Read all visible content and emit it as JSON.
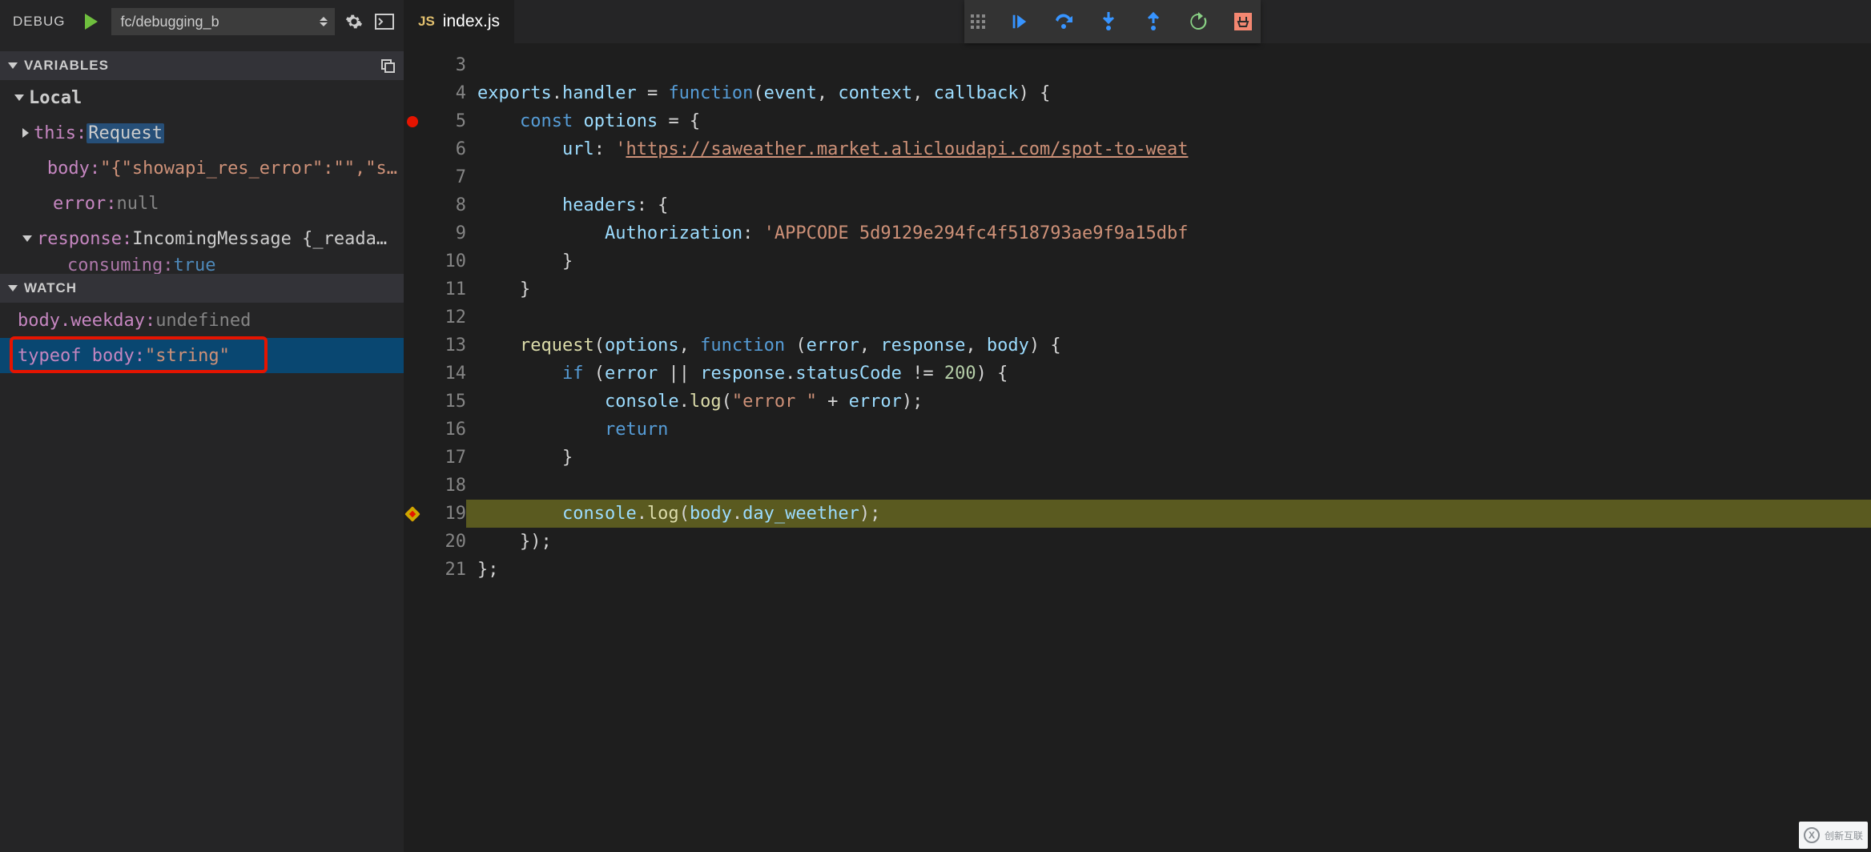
{
  "debug": {
    "title": "DEBUG",
    "config_name": "fc/debugging_b"
  },
  "sections": {
    "variables_title": "VARIABLES",
    "watch_title": "WATCH"
  },
  "variables": {
    "scope_local": "Local",
    "rows": [
      {
        "name": "this",
        "value": "Request",
        "indent": 28,
        "arrow": "collapsed",
        "valClass": "highlighted-val"
      },
      {
        "name": "body",
        "value": "\"{\"showapi_res_error\":\"\",\"s…",
        "indent": 46,
        "arrow": "",
        "valClass": "var-value str"
      },
      {
        "name": "error",
        "value": "null",
        "indent": 46,
        "arrow": "",
        "valClass": "var-value null"
      },
      {
        "name": "response",
        "value": "IncomingMessage {_reada…",
        "indent": 28,
        "arrow": "expanded",
        "valClass": "var-value obj"
      },
      {
        "name": "consuming",
        "value": "true",
        "indent": 64,
        "arrow": "",
        "valClass": "var-value bool",
        "truncated": true
      }
    ]
  },
  "watch": [
    {
      "expr": "body.weekday",
      "value": "undefined",
      "valClass": "var-value null"
    },
    {
      "expr": "typeof body",
      "value": "\"string\"",
      "valClass": "var-value str",
      "selected": true,
      "boxed": true
    }
  ],
  "editor": {
    "filename": "index.js",
    "lang_badge": "JS",
    "lines": [
      {
        "n": 3,
        "bp": "",
        "current": false,
        "tokens": []
      },
      {
        "n": 4,
        "bp": "",
        "current": false,
        "tokens": [
          [
            "id",
            "exports"
          ],
          [
            "pun",
            "."
          ],
          [
            "id",
            "handler"
          ],
          [
            "plain",
            " "
          ],
          [
            "pun",
            "="
          ],
          [
            "plain",
            " "
          ],
          [
            "kw",
            "function"
          ],
          [
            "pun",
            "("
          ],
          [
            "id",
            "event"
          ],
          [
            "pun",
            ", "
          ],
          [
            "id",
            "context"
          ],
          [
            "pun",
            ", "
          ],
          [
            "id",
            "callback"
          ],
          [
            "pun",
            ") {"
          ]
        ]
      },
      {
        "n": 5,
        "bp": "dot",
        "current": false,
        "pad": "    ",
        "tokens": [
          [
            "kw",
            "const"
          ],
          [
            "plain",
            " "
          ],
          [
            "id",
            "options"
          ],
          [
            "plain",
            " "
          ],
          [
            "pun",
            "="
          ],
          [
            "plain",
            " {"
          ]
        ]
      },
      {
        "n": 6,
        "bp": "",
        "current": false,
        "pad": "        ",
        "tokens": [
          [
            "prop",
            "url"
          ],
          [
            "pun",
            ":"
          ],
          [
            "plain",
            " "
          ],
          [
            "str",
            "'"
          ],
          [
            "strU",
            "https://saweather.market.alicloudapi.com/spot-to-weat"
          ]
        ]
      },
      {
        "n": 7,
        "bp": "",
        "current": false,
        "tokens": []
      },
      {
        "n": 8,
        "bp": "",
        "current": false,
        "pad": "        ",
        "tokens": [
          [
            "prop",
            "headers"
          ],
          [
            "pun",
            ":"
          ],
          [
            "plain",
            " {"
          ]
        ]
      },
      {
        "n": 9,
        "bp": "",
        "current": false,
        "pad": "            ",
        "tokens": [
          [
            "prop",
            "Authorization"
          ],
          [
            "pun",
            ":"
          ],
          [
            "plain",
            " "
          ],
          [
            "str",
            "'APPCODE 5d9129e294fc4f518793ae9f9a15dbf"
          ]
        ]
      },
      {
        "n": 10,
        "bp": "",
        "current": false,
        "pad": "        ",
        "tokens": [
          [
            "pun",
            "}"
          ]
        ]
      },
      {
        "n": 11,
        "bp": "",
        "current": false,
        "pad": "    ",
        "tokens": [
          [
            "pun",
            "}"
          ]
        ]
      },
      {
        "n": 12,
        "bp": "",
        "current": false,
        "tokens": []
      },
      {
        "n": 13,
        "bp": "",
        "current": false,
        "pad": "    ",
        "tokens": [
          [
            "fn",
            "request"
          ],
          [
            "pun",
            "("
          ],
          [
            "id",
            "options"
          ],
          [
            "pun",
            ", "
          ],
          [
            "kw",
            "function"
          ],
          [
            "plain",
            " "
          ],
          [
            "pun",
            "("
          ],
          [
            "id",
            "error"
          ],
          [
            "pun",
            ", "
          ],
          [
            "id",
            "response"
          ],
          [
            "pun",
            ", "
          ],
          [
            "id",
            "body"
          ],
          [
            "pun",
            ") {"
          ]
        ]
      },
      {
        "n": 14,
        "bp": "",
        "current": false,
        "pad": "        ",
        "tokens": [
          [
            "kw",
            "if"
          ],
          [
            "plain",
            " "
          ],
          [
            "pun",
            "("
          ],
          [
            "id",
            "error"
          ],
          [
            "plain",
            " "
          ],
          [
            "pun",
            "||"
          ],
          [
            "plain",
            " "
          ],
          [
            "id",
            "response"
          ],
          [
            "pun",
            "."
          ],
          [
            "id",
            "statusCode"
          ],
          [
            "plain",
            " "
          ],
          [
            "pun",
            "!="
          ],
          [
            "plain",
            " "
          ],
          [
            "num",
            "200"
          ],
          [
            "pun",
            ") {"
          ]
        ]
      },
      {
        "n": 15,
        "bp": "",
        "current": false,
        "pad": "            ",
        "tokens": [
          [
            "id",
            "console"
          ],
          [
            "pun",
            "."
          ],
          [
            "fn",
            "log"
          ],
          [
            "pun",
            "("
          ],
          [
            "str",
            "\"error \""
          ],
          [
            "plain",
            " "
          ],
          [
            "pun",
            "+"
          ],
          [
            "plain",
            " "
          ],
          [
            "id",
            "error"
          ],
          [
            "pun",
            ");"
          ]
        ]
      },
      {
        "n": 16,
        "bp": "",
        "current": false,
        "pad": "            ",
        "tokens": [
          [
            "kw",
            "return"
          ]
        ]
      },
      {
        "n": 17,
        "bp": "",
        "current": false,
        "pad": "        ",
        "tokens": [
          [
            "pun",
            "}"
          ]
        ]
      },
      {
        "n": 18,
        "bp": "",
        "current": false,
        "tokens": []
      },
      {
        "n": 19,
        "bp": "cond",
        "current": true,
        "pad": "        ",
        "tokens": [
          [
            "id",
            "console"
          ],
          [
            "pun",
            "."
          ],
          [
            "fn",
            "log"
          ],
          [
            "pun",
            "("
          ],
          [
            "id",
            "body"
          ],
          [
            "pun",
            "."
          ],
          [
            "id",
            "day_weether"
          ],
          [
            "pun",
            ");"
          ]
        ]
      },
      {
        "n": 20,
        "bp": "",
        "current": false,
        "pad": "    ",
        "tokens": [
          [
            "pun",
            "});"
          ]
        ]
      },
      {
        "n": 21,
        "bp": "",
        "current": false,
        "tokens": [
          [
            "pun",
            "};"
          ]
        ]
      }
    ]
  },
  "watermark": {
    "text": "创新互联"
  }
}
